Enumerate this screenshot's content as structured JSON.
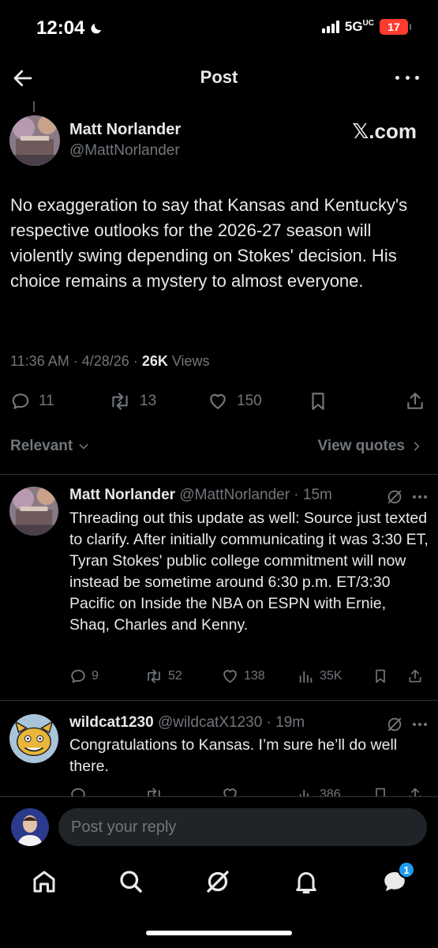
{
  "status": {
    "time": "12:04",
    "network": "5G",
    "network_sub": "UC",
    "battery": "17"
  },
  "header": {
    "title": "Post"
  },
  "main_post": {
    "name": "Matt Norlander",
    "handle": "@MattNorlander",
    "source": "𝕏.com",
    "text": "No exaggeration to say that Kansas and Kentucky's respective outlooks for the 2026-27 season will violently swing depending on Stokes' decision. His choice remains a mystery to almost everyone.",
    "time": "11:36 AM",
    "date": "4/28/26",
    "views": "26K",
    "views_label": "Views",
    "replies": "11",
    "reposts": "13",
    "likes": "150"
  },
  "sort": {
    "label": "Relevant",
    "view_quotes": "View quotes"
  },
  "replies": [
    {
      "name": "Matt Norlander",
      "handle": "@MattNorlander",
      "age": "15m",
      "text": "Threading out this update as well: Source just texted to clarify. After initially communicating it was 3:30 ET, Tyran Stokes' public college commitment will now instead be sometime around 6:30 p.m. ET/3:30 Pacific on Inside the NBA on ESPN with Ernie, Shaq, Charles and Kenny.",
      "replies": "9",
      "reposts": "52",
      "likes": "138",
      "views": "35K"
    },
    {
      "name": "wildcat1230",
      "handle": "@wildcatX1230",
      "age": "19m",
      "text": "Congratulations to Kansas.  I’m sure he’ll do well there.",
      "views": "386"
    }
  ],
  "composer": {
    "placeholder": "Post your reply"
  },
  "nav": {
    "messages_badge": "1"
  },
  "colors": {
    "background": "#000000",
    "text": "#e7e9ea",
    "muted": "#71767b",
    "accent": "#1d9bf0",
    "battery": "#ff3b30"
  }
}
